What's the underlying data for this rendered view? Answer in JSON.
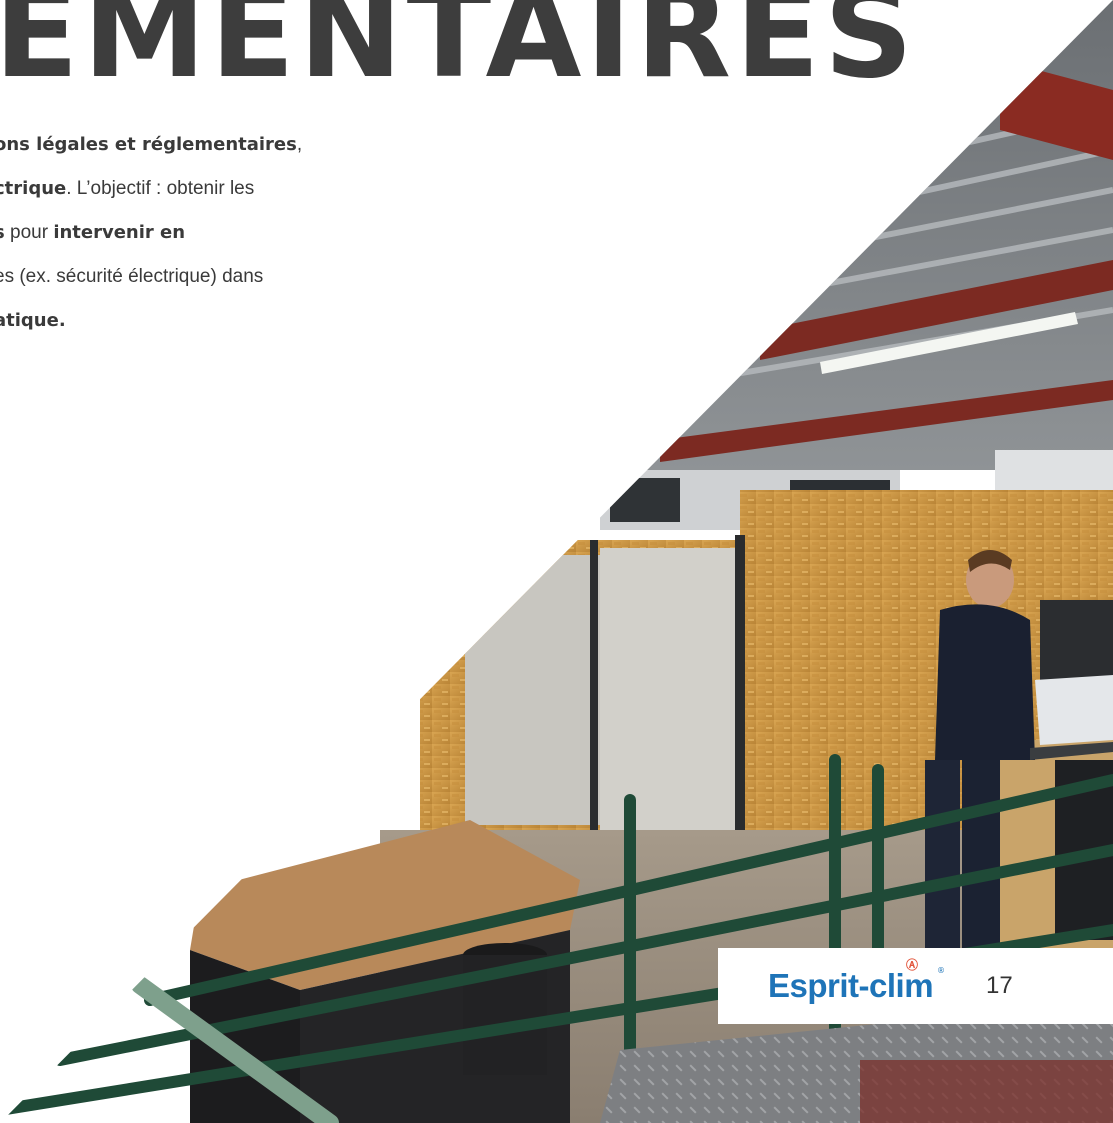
{
  "heading": "EMENTAIRES",
  "body_lines": [
    [
      {
        "t": "ons légales et  réglementaires",
        "b": true
      },
      {
        "t": ",",
        "b": false
      }
    ],
    [
      {
        "t": "ctrique",
        "b": true
      },
      {
        "t": ". L’objectif : obtenir les",
        "b": false
      }
    ],
    [
      {
        "t": "s",
        "b": true
      },
      {
        "t": " pour ",
        "b": false
      },
      {
        "t": "intervenir  en",
        "b": true
      }
    ],
    [
      {
        "t": "es (ex. sécurité  électrique) dans",
        "b": false
      }
    ],
    [
      {
        "t": "atique.",
        "b": true
      }
    ]
  ],
  "logo": {
    "text": "Esprit-clim",
    "mark": "®",
    "brand_color": "#1e74b8",
    "accent_color": "#e2553b"
  },
  "page_number": "17",
  "photo_icon": "workshop-photo"
}
